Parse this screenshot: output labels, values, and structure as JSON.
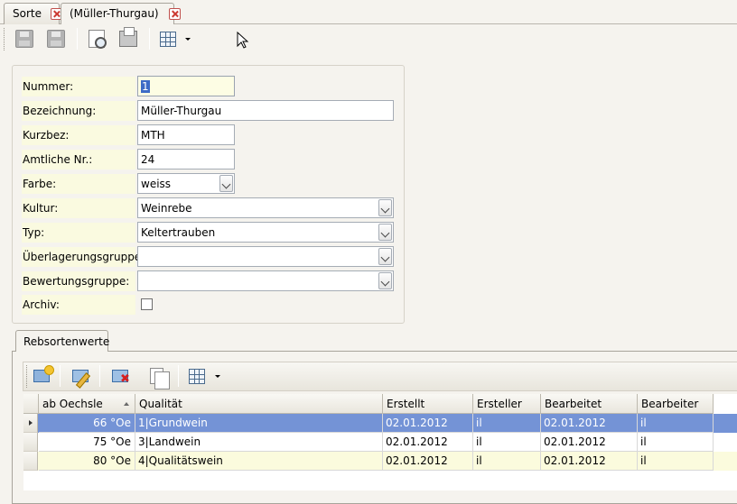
{
  "tabs": [
    {
      "label": "Sorte",
      "close_icon": "close-icon"
    },
    {
      "label": "(Müller-Thurgau)",
      "close_icon": "close-icon"
    }
  ],
  "toolbar": {
    "icons": [
      "save-close-icon",
      "save-icon",
      "print-preview-icon",
      "print-icon",
      "grid-layout-icon"
    ]
  },
  "form": {
    "nummer": {
      "label": "Nummer:",
      "value": "1"
    },
    "bezeichnung": {
      "label": "Bezeichnung:",
      "value": "Müller-Thurgau"
    },
    "kurzbez": {
      "label": "Kurzbez:",
      "value": "MTH"
    },
    "amtliche_nr": {
      "label": "Amtliche Nr.:",
      "value": "24"
    },
    "farbe": {
      "label": "Farbe:",
      "value": "weiss"
    },
    "kultur": {
      "label": "Kultur:",
      "value": "Weinrebe"
    },
    "typ": {
      "label": "Typ:",
      "value": "Keltertrauben"
    },
    "ueberlagerungsgruppe": {
      "label": "Überlagerungsgruppe:",
      "value": ""
    },
    "bewertungsgruppe": {
      "label": "Bewertungsgruppe:",
      "value": ""
    },
    "archiv": {
      "label": "Archiv:",
      "checked": false
    }
  },
  "subtab": {
    "label": "Rebsortenwerte"
  },
  "grid": {
    "toolbar_icons": [
      "add-icon",
      "edit-icon",
      "delete-icon",
      "copy-icon",
      "grid-layout-icon"
    ],
    "columns": [
      "ab Oechsle",
      "Qualität",
      "Erstellt",
      "Ersteller",
      "Bearbeitet",
      "Bearbeiter"
    ],
    "rows": [
      {
        "oechsle": "66 °Oe",
        "qualitaet": "1|Grundwein",
        "erstellt": "02.01.2012",
        "ersteller": "il",
        "bearbeitet": "02.01.2012",
        "bearbeiter": "il"
      },
      {
        "oechsle": "75 °Oe",
        "qualitaet": "3|Landwein",
        "erstellt": "02.01.2012",
        "ersteller": "il",
        "bearbeitet": "02.01.2012",
        "bearbeiter": "il"
      },
      {
        "oechsle": "80 °Oe",
        "qualitaet": "4|Qualitätswein",
        "erstellt": "02.01.2012",
        "ersteller": "il",
        "bearbeitet": "02.01.2012",
        "bearbeiter": "il"
      }
    ]
  },
  "colors": {
    "selection": "#7493d6",
    "label_bg": "#fafae0",
    "alt_row": "#fbfbdd"
  }
}
